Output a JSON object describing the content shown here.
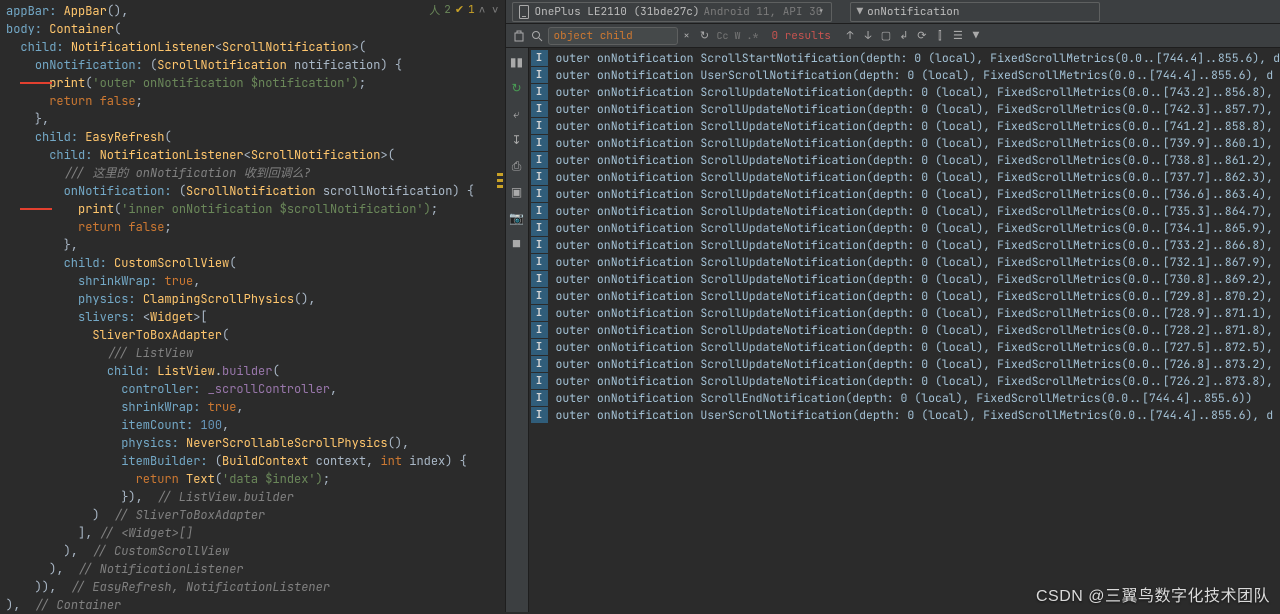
{
  "status": {
    "checks": "2",
    "warnings": "1",
    "nav": "∧  ∨"
  },
  "code": {
    "lines": [
      {
        "t": "appBar: AppBar(),",
        "cls": [
          {
            "s": 0,
            "e": 7,
            "c": "param"
          },
          {
            "s": 8,
            "e": 14,
            "c": "class"
          }
        ]
      },
      {
        "t": "body: Container(",
        "cls": [
          {
            "s": 0,
            "e": 5,
            "c": "param"
          },
          {
            "s": 6,
            "e": 15,
            "c": "class"
          }
        ]
      },
      {
        "t": "  child: NotificationListener<ScrollNotification>(",
        "cls": [
          {
            "s": 2,
            "e": 8,
            "c": "param"
          },
          {
            "s": 9,
            "e": 29,
            "c": "class"
          },
          {
            "s": 30,
            "e": 48,
            "c": "class"
          }
        ]
      },
      {
        "t": "    onNotification: (ScrollNotification notification) {",
        "cls": [
          {
            "s": 4,
            "e": 19,
            "c": "param"
          },
          {
            "s": 21,
            "e": 39,
            "c": "class"
          }
        ]
      },
      {
        "t": "      print('outer onNotification $notification');",
        "cls": [
          {
            "s": 6,
            "e": 11,
            "c": "class"
          },
          {
            "s": 12,
            "e": 49,
            "c": "string"
          }
        ],
        "mark": true
      },
      {
        "t": "      return false;",
        "cls": [
          {
            "s": 6,
            "e": 12,
            "c": "keyword"
          },
          {
            "s": 13,
            "e": 18,
            "c": "literal"
          }
        ]
      },
      {
        "t": "    },",
        "cls": []
      },
      {
        "t": "    child: EasyRefresh(",
        "cls": [
          {
            "s": 4,
            "e": 10,
            "c": "param"
          },
          {
            "s": 11,
            "e": 22,
            "c": "class"
          }
        ]
      },
      {
        "t": "      child: NotificationListener<ScrollNotification>(",
        "cls": [
          {
            "s": 6,
            "e": 12,
            "c": "param"
          },
          {
            "s": 13,
            "e": 33,
            "c": "class"
          },
          {
            "s": 34,
            "e": 52,
            "c": "class"
          }
        ]
      },
      {
        "t": "        /// 这里的 onNotification 收到回调么?",
        "cls": [
          {
            "s": 8,
            "e": 40,
            "c": "comment"
          }
        ]
      },
      {
        "t": "        onNotification: (ScrollNotification scrollNotification) {",
        "cls": [
          {
            "s": 8,
            "e": 23,
            "c": "param"
          },
          {
            "s": 25,
            "e": 43,
            "c": "class"
          }
        ]
      },
      {
        "t": "          print('inner onNotification $scrollNotification');",
        "cls": [
          {
            "s": 10,
            "e": 15,
            "c": "class"
          },
          {
            "s": 16,
            "e": 59,
            "c": "string"
          }
        ],
        "mark": true
      },
      {
        "t": "          return false;",
        "cls": [
          {
            "s": 10,
            "e": 16,
            "c": "keyword"
          },
          {
            "s": 17,
            "e": 22,
            "c": "literal"
          }
        ]
      },
      {
        "t": "        },",
        "cls": []
      },
      {
        "t": "        child: CustomScrollView(",
        "cls": [
          {
            "s": 8,
            "e": 14,
            "c": "param"
          },
          {
            "s": 15,
            "e": 31,
            "c": "class"
          }
        ]
      },
      {
        "t": "          shrinkWrap: true,",
        "cls": [
          {
            "s": 10,
            "e": 21,
            "c": "param"
          },
          {
            "s": 22,
            "e": 26,
            "c": "literal"
          }
        ]
      },
      {
        "t": "          physics: ClampingScrollPhysics(),",
        "cls": [
          {
            "s": 10,
            "e": 18,
            "c": "param"
          },
          {
            "s": 19,
            "e": 40,
            "c": "class"
          }
        ]
      },
      {
        "t": "          slivers: <Widget>[",
        "cls": [
          {
            "s": 10,
            "e": 18,
            "c": "param"
          },
          {
            "s": 20,
            "e": 26,
            "c": "class"
          }
        ]
      },
      {
        "t": "            SliverToBoxAdapter(",
        "cls": [
          {
            "s": 12,
            "e": 30,
            "c": "class"
          }
        ]
      },
      {
        "t": "              /// ListView",
        "cls": [
          {
            "s": 14,
            "e": 26,
            "c": "comment"
          }
        ]
      },
      {
        "t": "              child: ListView.builder(",
        "cls": [
          {
            "s": 14,
            "e": 20,
            "c": "param"
          },
          {
            "s": 21,
            "e": 29,
            "c": "class"
          },
          {
            "s": 30,
            "e": 37,
            "c": "ident"
          }
        ]
      },
      {
        "t": "                controller: _scrollController,",
        "cls": [
          {
            "s": 16,
            "e": 27,
            "c": "param"
          },
          {
            "s": 28,
            "e": 45,
            "c": "ident"
          }
        ]
      },
      {
        "t": "                shrinkWrap: true,",
        "cls": [
          {
            "s": 16,
            "e": 27,
            "c": "param"
          },
          {
            "s": 28,
            "e": 32,
            "c": "literal"
          }
        ]
      },
      {
        "t": "                itemCount: 100,",
        "cls": [
          {
            "s": 16,
            "e": 26,
            "c": "param"
          },
          {
            "s": 27,
            "e": 30,
            "c": "number"
          }
        ]
      },
      {
        "t": "                physics: NeverScrollableScrollPhysics(),",
        "cls": [
          {
            "s": 16,
            "e": 24,
            "c": "param"
          },
          {
            "s": 25,
            "e": 53,
            "c": "class"
          }
        ]
      },
      {
        "t": "                itemBuilder: (BuildContext context, int index) {",
        "cls": [
          {
            "s": 16,
            "e": 28,
            "c": "param"
          },
          {
            "s": 30,
            "e": 42,
            "c": "class"
          },
          {
            "s": 52,
            "e": 55,
            "c": "keyword"
          }
        ]
      },
      {
        "t": "                  return Text('data $index');",
        "cls": [
          {
            "s": 18,
            "e": 24,
            "c": "keyword"
          },
          {
            "s": 25,
            "e": 29,
            "c": "class"
          },
          {
            "s": 30,
            "e": 44,
            "c": "string"
          }
        ]
      },
      {
        "t": "                }),  // ListView.builder",
        "cls": [
          {
            "s": 21,
            "e": 40,
            "c": "comment"
          }
        ]
      },
      {
        "t": "            )  // SliverToBoxAdapter",
        "cls": [
          {
            "s": 15,
            "e": 37,
            "c": "comment"
          }
        ]
      },
      {
        "t": "          ], // <Widget>[]",
        "cls": [
          {
            "s": 13,
            "e": 27,
            "c": "comment"
          }
        ]
      },
      {
        "t": "        ),  // CustomScrollView",
        "cls": [
          {
            "s": 12,
            "e": 31,
            "c": "comment"
          }
        ]
      },
      {
        "t": "      ),  // NotificationListener",
        "cls": [
          {
            "s": 10,
            "e": 33,
            "c": "comment"
          }
        ]
      },
      {
        "t": "    )),  // EasyRefresh, NotificationListener",
        "cls": [
          {
            "s": 9,
            "e": 46,
            "c": "comment"
          }
        ]
      },
      {
        "t": "),  // Container",
        "cls": [
          {
            "s": 4,
            "e": 16,
            "c": "comment"
          }
        ]
      }
    ]
  },
  "device": {
    "name": "OnePlus LE2110 (31bde27c)",
    "details": "Android 11, API 30"
  },
  "filter": {
    "text": "onNotification"
  },
  "search": {
    "query": "object child",
    "results": "0 results",
    "opts": [
      "Cc",
      "W",
      ".*"
    ]
  },
  "logs": [
    "outer onNotification ScrollStartNotification(depth: 0 (local), FixedScrollMetrics(0.0..[744.4]..855.6), d",
    "outer onNotification UserScrollNotification(depth: 0 (local), FixedScrollMetrics(0.0..[744.4]..855.6), d",
    "outer onNotification ScrollUpdateNotification(depth: 0 (local), FixedScrollMetrics(0.0..[743.2]..856.8),",
    "outer onNotification ScrollUpdateNotification(depth: 0 (local), FixedScrollMetrics(0.0..[742.3]..857.7),",
    "outer onNotification ScrollUpdateNotification(depth: 0 (local), FixedScrollMetrics(0.0..[741.2]..858.8),",
    "outer onNotification ScrollUpdateNotification(depth: 0 (local), FixedScrollMetrics(0.0..[739.9]..860.1),",
    "outer onNotification ScrollUpdateNotification(depth: 0 (local), FixedScrollMetrics(0.0..[738.8]..861.2),",
    "outer onNotification ScrollUpdateNotification(depth: 0 (local), FixedScrollMetrics(0.0..[737.7]..862.3),",
    "outer onNotification ScrollUpdateNotification(depth: 0 (local), FixedScrollMetrics(0.0..[736.6]..863.4),",
    "outer onNotification ScrollUpdateNotification(depth: 0 (local), FixedScrollMetrics(0.0..[735.3]..864.7),",
    "outer onNotification ScrollUpdateNotification(depth: 0 (local), FixedScrollMetrics(0.0..[734.1]..865.9),",
    "outer onNotification ScrollUpdateNotification(depth: 0 (local), FixedScrollMetrics(0.0..[733.2]..866.8),",
    "outer onNotification ScrollUpdateNotification(depth: 0 (local), FixedScrollMetrics(0.0..[732.1]..867.9),",
    "outer onNotification ScrollUpdateNotification(depth: 0 (local), FixedScrollMetrics(0.0..[730.8]..869.2),",
    "outer onNotification ScrollUpdateNotification(depth: 0 (local), FixedScrollMetrics(0.0..[729.8]..870.2),",
    "outer onNotification ScrollUpdateNotification(depth: 0 (local), FixedScrollMetrics(0.0..[728.9]..871.1),",
    "outer onNotification ScrollUpdateNotification(depth: 0 (local), FixedScrollMetrics(0.0..[728.2]..871.8),",
    "outer onNotification ScrollUpdateNotification(depth: 0 (local), FixedScrollMetrics(0.0..[727.5]..872.5),",
    "outer onNotification ScrollUpdateNotification(depth: 0 (local), FixedScrollMetrics(0.0..[726.8]..873.2),",
    "outer onNotification ScrollUpdateNotification(depth: 0 (local), FixedScrollMetrics(0.0..[726.2]..873.8),",
    "outer onNotification ScrollEndNotification(depth: 0 (local), FixedScrollMetrics(0.0..[744.4]..855.6))",
    "outer onNotification UserScrollNotification(depth: 0 (local), FixedScrollMetrics(0.0..[744.4]..855.6), d"
  ],
  "watermark": "CSDN @三翼鸟数字化技术团队"
}
